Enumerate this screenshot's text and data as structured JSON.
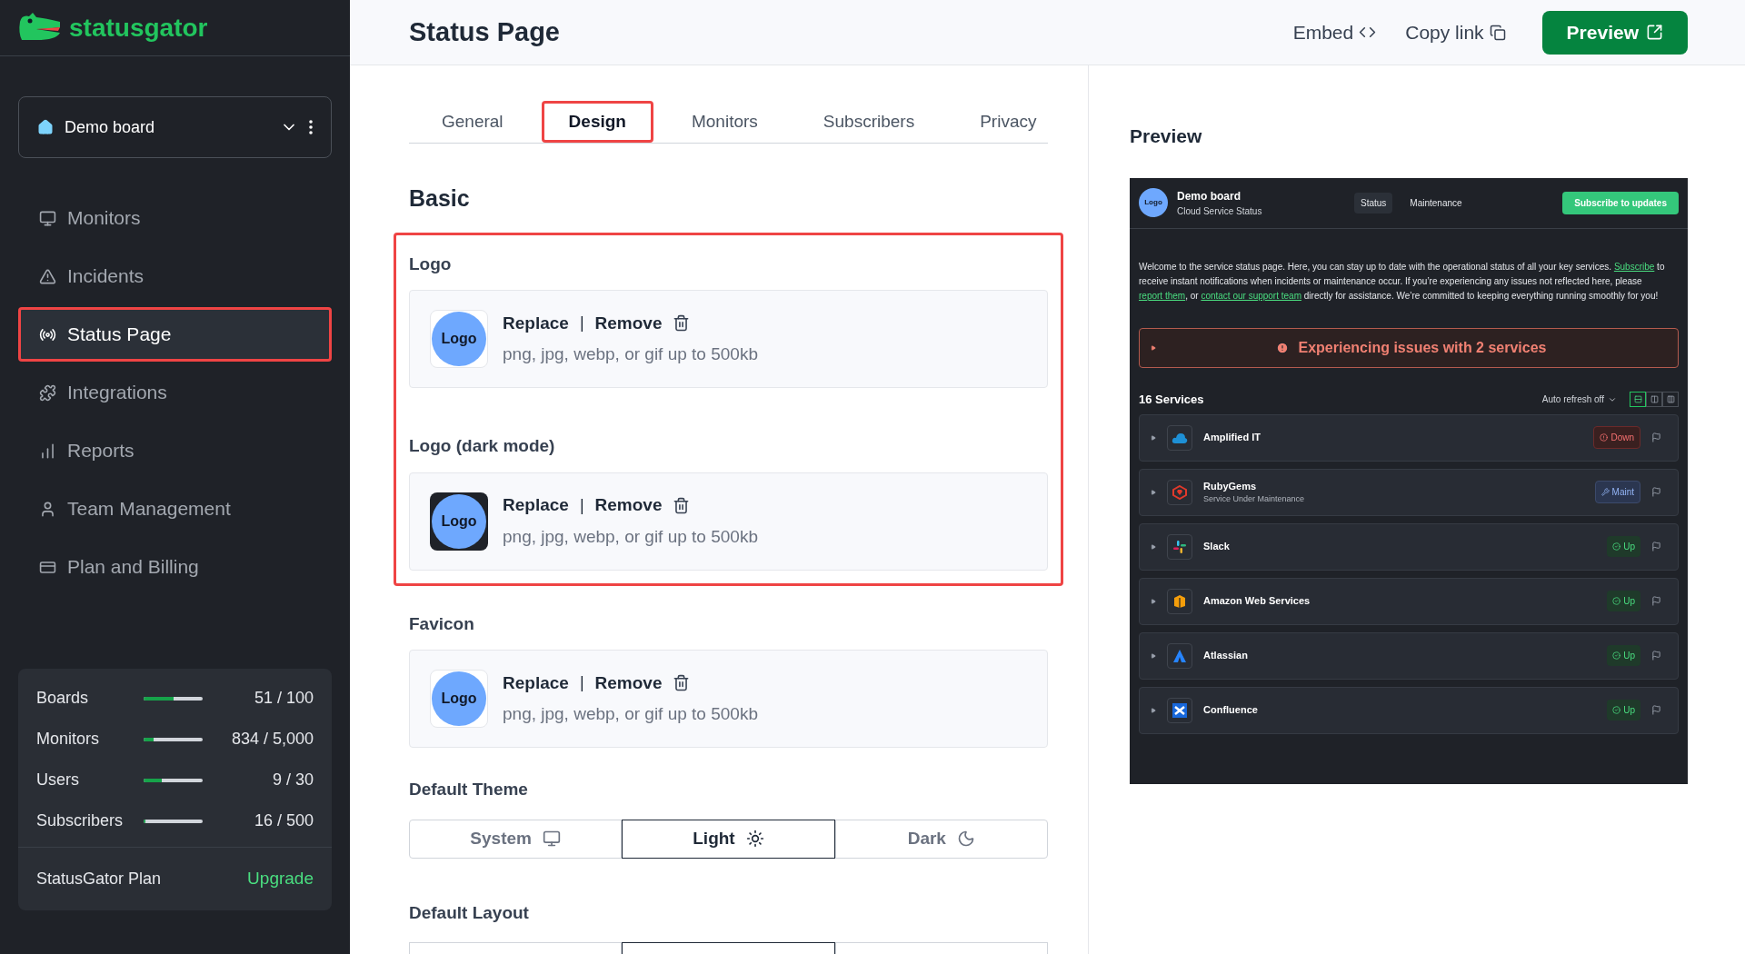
{
  "sidebar": {
    "logo_text": "statusgator",
    "board_selector": {
      "label": "Demo board"
    },
    "nav_items": [
      {
        "label": "Monitors",
        "selected": false,
        "highlighted": false
      },
      {
        "label": "Incidents",
        "selected": false,
        "highlighted": false
      },
      {
        "label": "Status Page",
        "selected": true,
        "highlighted": true
      },
      {
        "label": "Integrations",
        "selected": false,
        "highlighted": false
      },
      {
        "label": "Reports",
        "selected": false,
        "highlighted": false
      },
      {
        "label": "Team Management",
        "selected": false,
        "highlighted": false
      },
      {
        "label": "Plan and Billing",
        "selected": false,
        "highlighted": false
      }
    ],
    "usage": [
      {
        "label": "Boards",
        "level": 0.51,
        "reading": "51 / 100"
      },
      {
        "label": "Monitors",
        "level": 0.17,
        "reading": "834 / 5,000"
      },
      {
        "label": "Users",
        "level": 0.3,
        "reading": "9 / 30"
      },
      {
        "label": "Subscribers",
        "level": 0.03,
        "reading": "16 / 500"
      }
    ],
    "plan": {
      "label": "StatusGator Plan",
      "link": "Upgrade"
    }
  },
  "header": {
    "title": "Status Page",
    "embed": "Embed",
    "copy_link": "Copy link",
    "preview_button": "Preview"
  },
  "tabs": [
    {
      "label": "General",
      "selected": false,
      "highlighted": false
    },
    {
      "label": "Design",
      "selected": true,
      "highlighted": true
    },
    {
      "label": "Monitors",
      "selected": false,
      "highlighted": false
    },
    {
      "label": "Subscribers",
      "selected": false,
      "highlighted": false
    },
    {
      "label": "Privacy",
      "selected": false,
      "highlighted": false
    }
  ],
  "section_title": "Basic",
  "uploads": [
    {
      "label": "Logo",
      "dark": false,
      "highlighted": true,
      "image_text": "Logo",
      "replace": "Replace",
      "separator": "|",
      "remove": "Remove",
      "hint": "png, jpg, webp, or gif up to 500kb"
    },
    {
      "label": "Logo (dark mode)",
      "dark": true,
      "highlighted": true,
      "image_text": "Logo",
      "replace": "Replace",
      "separator": "|",
      "remove": "Remove",
      "hint": "png, jpg, webp, or gif up to 500kb"
    },
    {
      "label": "Favicon",
      "dark": false,
      "highlighted": false,
      "image_text": "Logo",
      "replace": "Replace",
      "separator": "|",
      "remove": "Remove",
      "hint": "png, jpg, webp, or gif up to 500kb"
    }
  ],
  "default_theme": {
    "label": "Default Theme",
    "options": [
      {
        "label": "System",
        "kind": "system",
        "selected": false
      },
      {
        "label": "Light",
        "kind": "light",
        "selected": true
      },
      {
        "label": "Dark",
        "kind": "dark",
        "selected": false
      }
    ]
  },
  "default_layout": {
    "label": "Default Layout",
    "options": [
      {
        "selected": false
      },
      {
        "selected": true
      },
      {
        "selected": false
      }
    ]
  },
  "preview": {
    "title": "Preview",
    "page": {
      "logo_text": "Logo",
      "name": "Demo board",
      "subtitle": "Cloud Service Status",
      "nav": [
        {
          "label": "Status",
          "selected": true
        },
        {
          "label": "Maintenance",
          "selected": false
        }
      ],
      "subscribe_button": "Subscribe to updates",
      "intro": [
        {
          "text": "Welcome to the service status page. Here, you can stay up to date with the operational status of all your key services. "
        },
        {
          "link": "Subscribe"
        },
        {
          "text": " to receive instant notifications when incidents or maintenance occur. If you’re experiencing any issues not reflected here, please "
        },
        {
          "link": "report them"
        },
        {
          "text": ", or "
        },
        {
          "link": "contact our support team"
        },
        {
          "text": " directly for assistance. We’re committed to keeping everything running smoothly for you!"
        }
      ],
      "alert": "Experiencing issues with 2 services",
      "services_count": "16 Services",
      "auto_refresh": "Auto refresh off",
      "view_modes": [
        {
          "selected": true
        },
        {
          "selected": false
        },
        {
          "selected": false
        }
      ],
      "services": [
        {
          "name": "Amplified IT",
          "kind": "down",
          "badge": "Down"
        },
        {
          "name": "RubyGems",
          "subtitle": "Service Under Maintenance",
          "kind": "maint",
          "badge": "Maint"
        },
        {
          "name": "Slack",
          "kind": "up",
          "badge": "Up"
        },
        {
          "name": "Amazon Web Services",
          "kind": "up",
          "badge": "Up"
        },
        {
          "name": "Atlassian",
          "kind": "up",
          "badge": "Up"
        },
        {
          "name": "Confluence",
          "kind": "up",
          "badge": "Up"
        }
      ]
    }
  }
}
